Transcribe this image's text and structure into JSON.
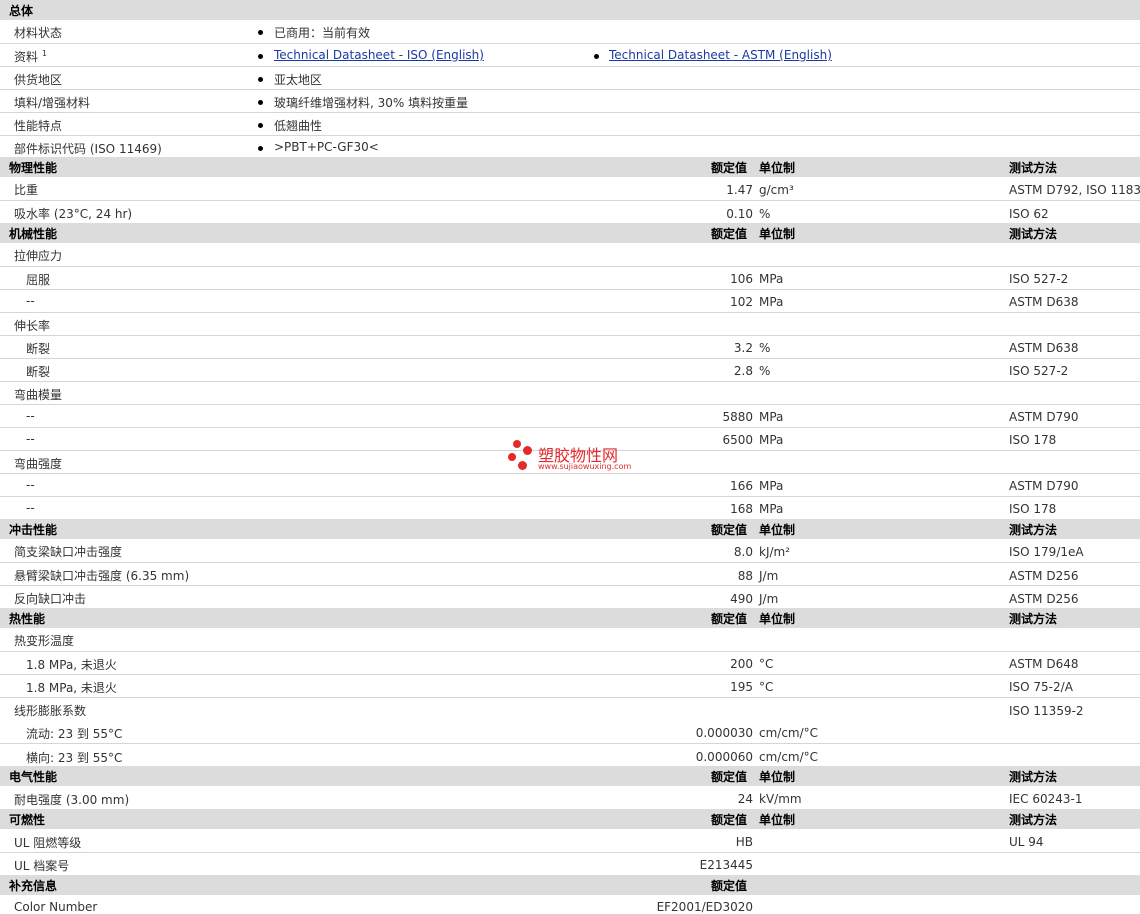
{
  "sections": {
    "general": "总体",
    "physical": "物理性能",
    "mechanical": "机械性能",
    "impact": "冲击性能",
    "thermal": "热性能",
    "electrical": "电气性能",
    "flammability": "可燃性",
    "additional": "补充信息"
  },
  "headers": {
    "nominal": "额定值",
    "unit": "单位制",
    "method": "测试方法"
  },
  "general": {
    "status_label": "材料状态",
    "status_prefix": "已商用：",
    "status_value": "当前有效",
    "docs_label": "资料",
    "docs_sup": "1",
    "doc1": "Technical Datasheet - ISO (English)",
    "doc2": "Technical Datasheet - ASTM (English)",
    "region_label": "供货地区",
    "region_value": "亚太地区",
    "filler_label": "填料/增强材料",
    "filler_value": "玻璃纤维增强材料, 30% 填料按重量",
    "feature_label": "性能特点",
    "feature_value": "低翘曲性",
    "marking_label": "部件标识代码",
    "marking_paren": "(ISO 11469)",
    "marking_value": ">PBT+PC-GF30<"
  },
  "physical": [
    {
      "label": "比重",
      "paren": "",
      "value": "1.47",
      "unit": "g/cm³",
      "method": "ASTM D792, ISO 1183"
    },
    {
      "label": "吸水率",
      "paren": "(23°C, 24 hr)",
      "value": "0.10",
      "unit": "%",
      "method": "ISO 62"
    }
  ],
  "mechanical": {
    "tensile": "拉伸应力",
    "yield": "屈服",
    "dash": "--",
    "t1": {
      "value": "106",
      "unit": "MPa",
      "method": "ISO 527-2"
    },
    "t2": {
      "value": "102",
      "unit": "MPa",
      "method": "ASTM D638"
    },
    "elong": "伸长率",
    "break": "断裂",
    "e1": {
      "value": "3.2",
      "unit": "%",
      "method": "ASTM D638"
    },
    "e2": {
      "value": "2.8",
      "unit": "%",
      "method": "ISO 527-2"
    },
    "fmod": "弯曲模量",
    "f1": {
      "value": "5880",
      "unit": "MPa",
      "method": "ASTM D790"
    },
    "f2": {
      "value": "6500",
      "unit": "MPa",
      "method": "ISO 178"
    },
    "fstr": "弯曲强度",
    "s1": {
      "value": "166",
      "unit": "MPa",
      "method": "ASTM D790"
    },
    "s2": {
      "value": "168",
      "unit": "MPa",
      "method": "ISO 178"
    }
  },
  "impact": [
    {
      "label": "简支梁缺口冲击强度",
      "paren": "",
      "value": "8.0",
      "unit": "kJ/m²",
      "method": "ISO 179/1eA"
    },
    {
      "label": "悬臂梁缺口冲击强度",
      "paren": "(6.35 mm)",
      "value": "88",
      "unit": "J/m",
      "method": "ASTM D256"
    },
    {
      "label": "反向缺口冲击",
      "paren": "",
      "value": "490",
      "unit": "J/m",
      "method": "ASTM D256"
    }
  ],
  "thermal": {
    "hdt": "热变形温度",
    "h1": {
      "label": "1.8 MPa, 未退火",
      "value": "200",
      "unit": "°C",
      "method": "ASTM D648"
    },
    "h2": {
      "label": "1.8 MPa, 未退火",
      "value": "195",
      "unit": "°C",
      "method": "ISO 75-2/A"
    },
    "clte": "线形膨胀系数",
    "clte_method": "ISO 11359-2",
    "c1": {
      "label": "流动: 23 到  55°C",
      "value": "0.000030",
      "unit": "cm/cm/°C"
    },
    "c2": {
      "label": "横向: 23 到  55°C",
      "value": "0.000060",
      "unit": "cm/cm/°C"
    }
  },
  "electrical": {
    "label": "耐电强度",
    "paren": "(3.00 mm)",
    "value": "24",
    "unit": "kV/mm",
    "method": "IEC 60243-1"
  },
  "flammability": {
    "ul_label": "UL 阻燃等级",
    "ul_value": "HB",
    "ul_method": "UL 94",
    "file_label": "UL 档案号",
    "file_value": "E213445"
  },
  "additional": {
    "color_label": "Color Number",
    "color_value": "EF2001/ED3020"
  },
  "watermark": {
    "title": "塑胶物性网",
    "url": "www.sujiaowuxing.com"
  }
}
